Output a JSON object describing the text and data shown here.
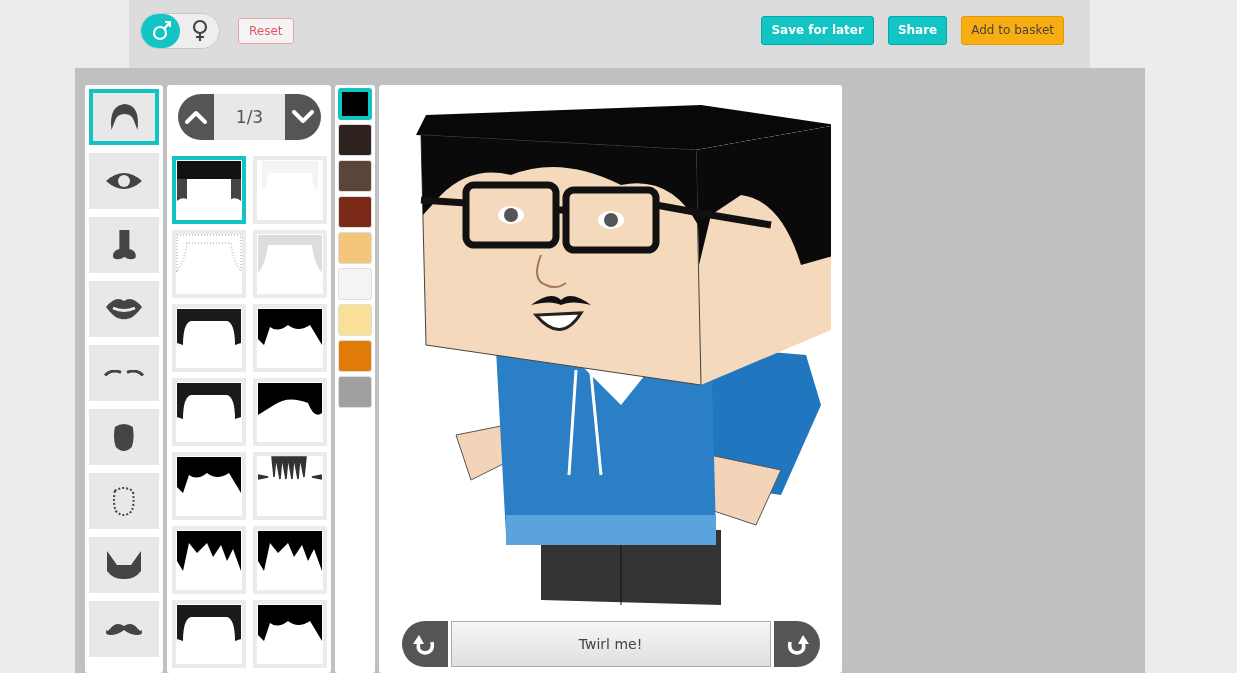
{
  "gender_toggle": [
    {
      "kind": "male",
      "selected": true
    },
    {
      "kind": "female",
      "selected": false
    }
  ],
  "reset_button": "Reset",
  "actions": [
    {
      "label": "Save for later",
      "kind": "primary"
    },
    {
      "label": "Share",
      "kind": "primary"
    },
    {
      "label": "Add to basket",
      "kind": "basket"
    }
  ],
  "categories": [
    {
      "kind": "hair",
      "selected": true
    },
    {
      "kind": "eye",
      "selected": false
    },
    {
      "kind": "nose",
      "selected": false
    },
    {
      "kind": "lips",
      "selected": false
    },
    {
      "kind": "eyebrows",
      "selected": false
    },
    {
      "kind": "face",
      "selected": false
    },
    {
      "kind": "face-outline",
      "selected": false
    },
    {
      "kind": "beard",
      "selected": false
    },
    {
      "kind": "mustache",
      "selected": false
    }
  ],
  "pager": {
    "label": "1/3"
  },
  "styles": [
    {
      "kind": "dark",
      "selected": true
    },
    {
      "kind": "blank",
      "selected": false
    },
    {
      "kind": "stubble-light",
      "selected": false
    },
    {
      "kind": "stubble",
      "selected": false
    },
    {
      "kind": "flat",
      "selected": false
    },
    {
      "kind": "messy",
      "selected": false
    },
    {
      "kind": "flat",
      "selected": false
    },
    {
      "kind": "curly",
      "selected": false
    },
    {
      "kind": "messy",
      "selected": false
    },
    {
      "kind": "spikes",
      "selected": false
    },
    {
      "kind": "shaggy",
      "selected": false
    },
    {
      "kind": "shaggy",
      "selected": false
    },
    {
      "kind": "flat",
      "selected": false
    },
    {
      "kind": "messy",
      "selected": false
    }
  ],
  "colors": [
    {
      "color": "#000000",
      "selected": true
    },
    {
      "color": "#2e221e",
      "selected": false
    },
    {
      "color": "#5c4438",
      "selected": false
    },
    {
      "color": "#7a2a16",
      "selected": false
    },
    {
      "color": "#f4c67c",
      "selected": false
    },
    {
      "color": "#f4f4f2",
      "selected": false
    },
    {
      "color": "#f9df98",
      "selected": false
    },
    {
      "color": "#e07b08",
      "selected": false
    },
    {
      "color": "#a0a09e",
      "selected": false
    }
  ],
  "twirl": {
    "label": "Twirl me!"
  }
}
